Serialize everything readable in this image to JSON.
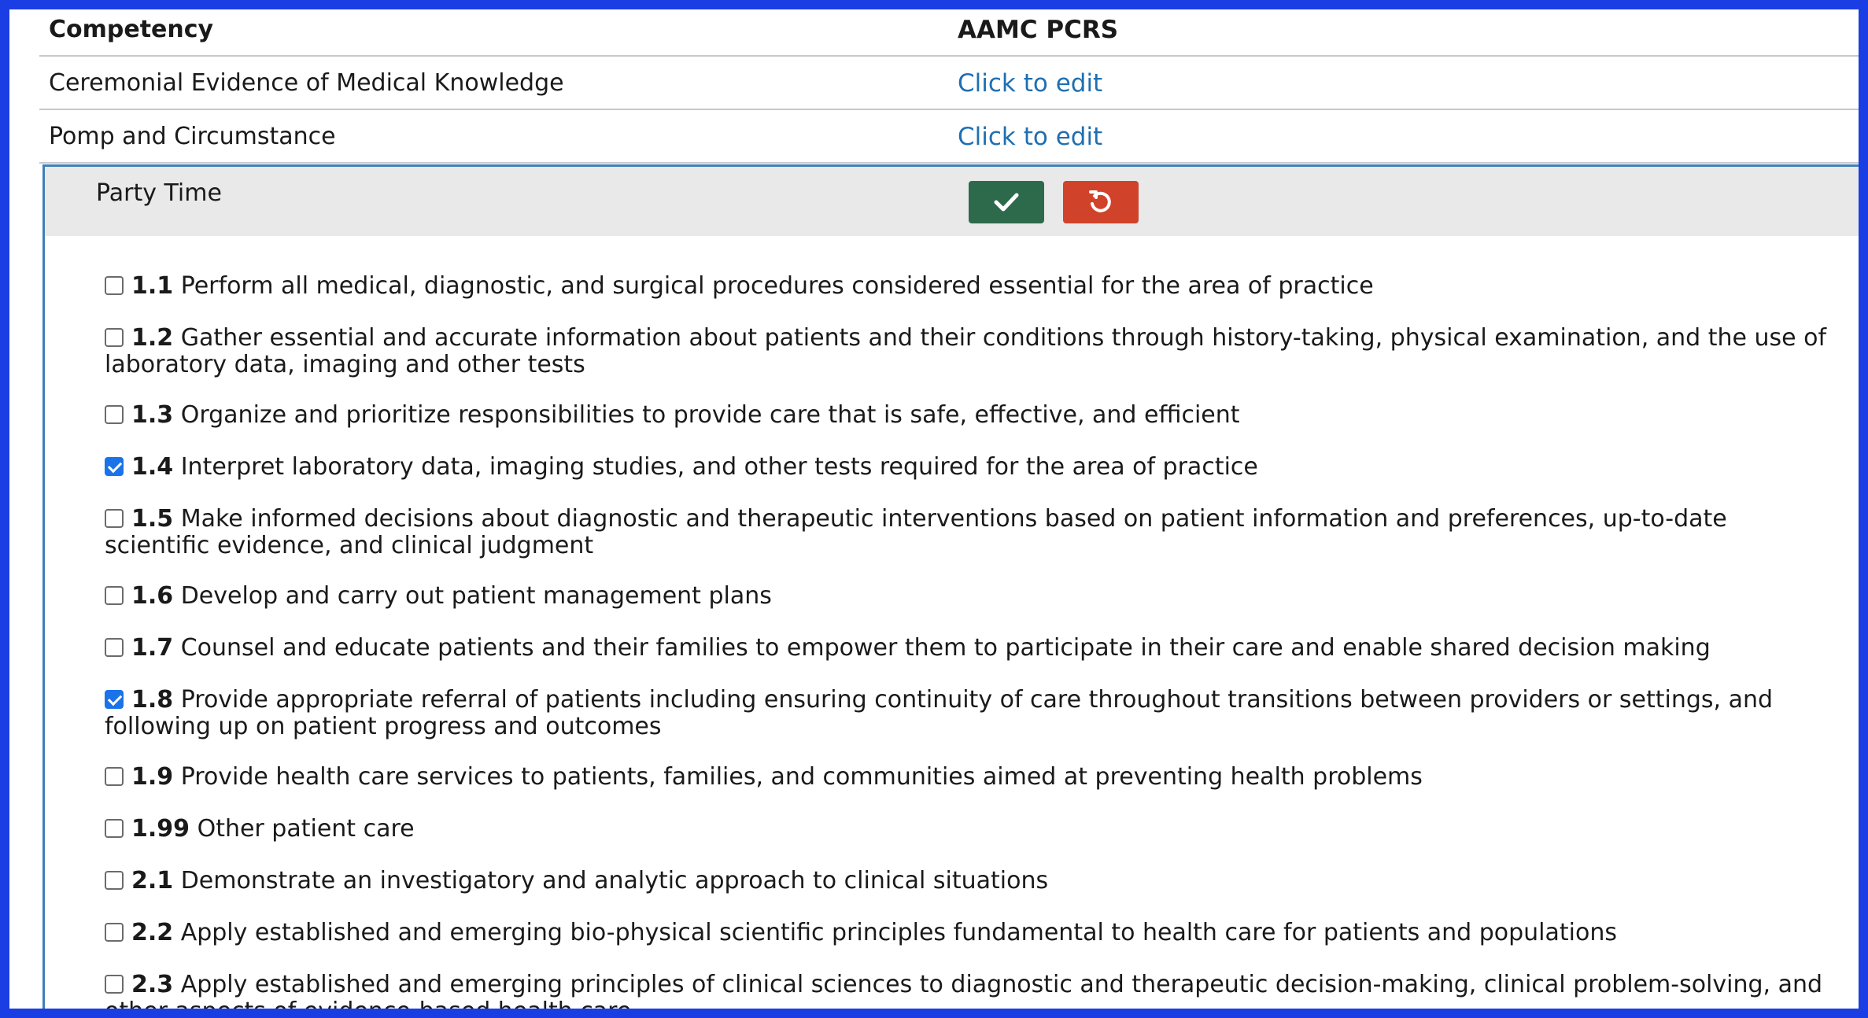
{
  "table": {
    "header": {
      "col1": "Competency",
      "col2": "AAMC PCRS"
    },
    "rows": [
      {
        "competency": "Ceremonial Evidence of Medical Knowledge",
        "action": "Click to edit"
      },
      {
        "competency": "Pomp and Circumstance",
        "action": "Click to edit"
      }
    ]
  },
  "editor": {
    "title": "Party Time",
    "save_icon": "check-icon",
    "revert_icon": "undo-icon",
    "colors": {
      "save": "#2d6a4c",
      "revert": "#d0432a",
      "accent": "#1b3de4",
      "link": "#1f6fb2"
    },
    "options": [
      {
        "num": "1.1",
        "text": "Perform all medical, diagnostic, and surgical procedures considered essential for the area of practice",
        "checked": false
      },
      {
        "num": "1.2",
        "text": "Gather essential and accurate information about patients and their conditions through history-taking, physical examination, and the use of laboratory data, imaging and other tests",
        "checked": false
      },
      {
        "num": "1.3",
        "text": "Organize and prioritize responsibilities to provide care that is safe, effective, and efficient",
        "checked": false
      },
      {
        "num": "1.4",
        "text": "Interpret laboratory data, imaging studies, and other tests required for the area of practice",
        "checked": true
      },
      {
        "num": "1.5",
        "text": "Make informed decisions about diagnostic and therapeutic interventions based on patient information and preferences, up-to-date scientific evidence, and clinical judgment",
        "checked": false
      },
      {
        "num": "1.6",
        "text": "Develop and carry out patient management plans",
        "checked": false
      },
      {
        "num": "1.7",
        "text": "Counsel and educate patients and their families to empower them to participate in their care and enable shared decision making",
        "checked": false
      },
      {
        "num": "1.8",
        "text": "Provide appropriate referral of patients including ensuring continuity of care throughout transitions between providers or settings, and following up on patient progress and outcomes",
        "checked": true
      },
      {
        "num": "1.9",
        "text": "Provide health care services to patients, families, and communities aimed at preventing health problems",
        "checked": false
      },
      {
        "num": "1.99",
        "text": "Other patient care",
        "checked": false
      },
      {
        "num": "2.1",
        "text": "Demonstrate an investigatory and analytic approach to clinical situations",
        "checked": false
      },
      {
        "num": "2.2",
        "text": "Apply established and emerging bio-physical scientific principles fundamental to health care for patients and populations",
        "checked": false
      },
      {
        "num": "2.3",
        "text": "Apply established and emerging principles of clinical sciences to diagnostic and therapeutic decision-making, clinical problem-solving, and other aspects of evidence-based health care",
        "checked": false
      }
    ]
  }
}
